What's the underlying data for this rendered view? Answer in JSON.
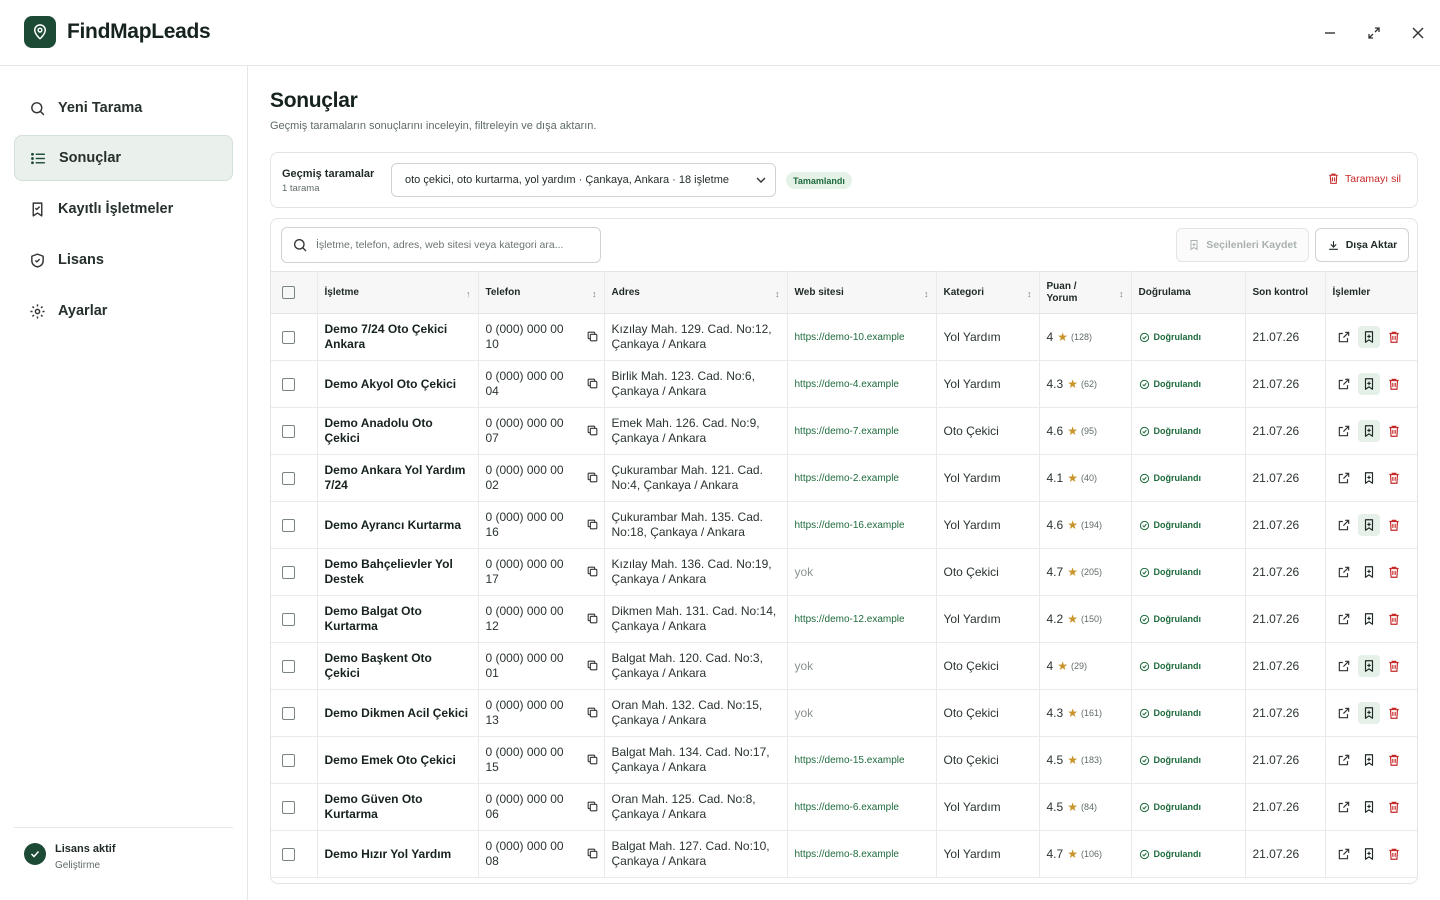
{
  "app": {
    "name": "FindMapLeads",
    "brand_color": "#1c4a35"
  },
  "sidebar": {
    "items": [
      {
        "label": "Yeni Tarama",
        "icon": "search-icon",
        "name": "sidebar-item-new-scan"
      },
      {
        "label": "Sonuçlar",
        "icon": "list-icon",
        "name": "sidebar-item-results",
        "active": true
      },
      {
        "label": "Kayıtlı İşletmeler",
        "icon": "bookmark-check-icon",
        "name": "sidebar-item-saved"
      },
      {
        "label": "Lisans",
        "icon": "shield-check-icon",
        "name": "sidebar-item-license"
      },
      {
        "label": "Ayarlar",
        "icon": "gear-icon",
        "name": "sidebar-item-settings"
      }
    ],
    "license": {
      "title": "Lisans aktif",
      "subtitle": "Geliştirme"
    }
  },
  "main": {
    "title": "Sonuçlar",
    "subtitle": "Geçmiş taramaların sonuçlarını inceleyin, filtreleyin ve dışa aktarın.",
    "filter": {
      "title": "Geçmiş taramalar",
      "count": "1 tarama",
      "selected_scan": "oto çekici, oto kurtarma, yol yardım · Çankaya, Ankara · 18 işletme",
      "status": "Tamamlandı",
      "delete_label": "Taramayı sil"
    },
    "toolbar": {
      "search_placeholder": "İşletme, telefon, adres, web sitesi veya kategori ara...",
      "save_selected": "Seçilenleri Kaydet",
      "export": "Dışa Aktar"
    },
    "table": {
      "headers": {
        "business": "İşletme",
        "phone": "Telefon",
        "address": "Adres",
        "website": "Web sitesi",
        "category": "Kategori",
        "rating": "Puan / Yorum",
        "verification": "Doğrulama",
        "last_check": "Son kontrol",
        "actions": "İşlemler"
      },
      "sort_icon": "↕",
      "sort_asc_icon": "↑",
      "rows": [
        {
          "name": "Demo 7/24 Oto Çekici Ankara",
          "phone": "0 (000) 000 00 10",
          "address": "Kızılay Mah. 129. Cad. No:12, Çankaya / Ankara",
          "website": "https://demo-10.example",
          "category": "Yol Yardım",
          "rating": "4",
          "reviews": "(128)",
          "verification": "Doğrulandı",
          "last_check": "21.07.26",
          "saved": true
        },
        {
          "name": "Demo Akyol Oto Çekici",
          "phone": "0 (000) 000 00 04",
          "address": "Birlik Mah. 123. Cad. No:6, Çankaya / Ankara",
          "website": "https://demo-4.example",
          "category": "Yol Yardım",
          "rating": "4.3",
          "reviews": "(62)",
          "verification": "Doğrulandı",
          "last_check": "21.07.26",
          "saved": true
        },
        {
          "name": "Demo Anadolu Oto Çekici",
          "phone": "0 (000) 000 00 07",
          "address": "Emek Mah. 126. Cad. No:9, Çankaya / Ankara",
          "website": "https://demo-7.example",
          "category": "Oto Çekici",
          "rating": "4.6",
          "reviews": "(95)",
          "verification": "Doğrulandı",
          "last_check": "21.07.26",
          "saved": true
        },
        {
          "name": "Demo Ankara Yol Yardım 7/24",
          "phone": "0 (000) 000 00 02",
          "address": "Çukurambar Mah. 121. Cad. No:4, Çankaya / Ankara",
          "website": "https://demo-2.example",
          "category": "Yol Yardım",
          "rating": "4.1",
          "reviews": "(40)",
          "verification": "Doğrulandı",
          "last_check": "21.07.26",
          "saved": false
        },
        {
          "name": "Demo Ayrancı Kurtarma",
          "phone": "0 (000) 000 00 16",
          "address": "Çukurambar Mah. 135. Cad. No:18, Çankaya / Ankara",
          "website": "https://demo-16.example",
          "category": "Yol Yardım",
          "rating": "4.6",
          "reviews": "(194)",
          "verification": "Doğrulandı",
          "last_check": "21.07.26",
          "saved": true
        },
        {
          "name": "Demo Bahçelievler Yol Destek",
          "phone": "0 (000) 000 00 17",
          "address": "Kızılay Mah. 136. Cad. No:19, Çankaya / Ankara",
          "website": "yok",
          "category": "Oto Çekici",
          "rating": "4.7",
          "reviews": "(205)",
          "verification": "Doğrulandı",
          "last_check": "21.07.26",
          "saved": false
        },
        {
          "name": "Demo Balgat Oto Kurtarma",
          "phone": "0 (000) 000 00 12",
          "address": "Dikmen Mah. 131. Cad. No:14, Çankaya / Ankara",
          "website": "https://demo-12.example",
          "category": "Yol Yardım",
          "rating": "4.2",
          "reviews": "(150)",
          "verification": "Doğrulandı",
          "last_check": "21.07.26",
          "saved": false
        },
        {
          "name": "Demo Başkent Oto Çekici",
          "phone": "0 (000) 000 00 01",
          "address": "Balgat Mah. 120. Cad. No:3, Çankaya / Ankara",
          "website": "yok",
          "category": "Oto Çekici",
          "rating": "4",
          "reviews": "(29)",
          "verification": "Doğrulandı",
          "last_check": "21.07.26",
          "saved": true
        },
        {
          "name": "Demo Dikmen Acil Çekici",
          "phone": "0 (000) 000 00 13",
          "address": "Oran Mah. 132. Cad. No:15, Çankaya / Ankara",
          "website": "yok",
          "category": "Oto Çekici",
          "rating": "4.3",
          "reviews": "(161)",
          "verification": "Doğrulandı",
          "last_check": "21.07.26",
          "saved": true
        },
        {
          "name": "Demo Emek Oto Çekici",
          "phone": "0 (000) 000 00 15",
          "address": "Balgat Mah. 134. Cad. No:17, Çankaya / Ankara",
          "website": "https://demo-15.example",
          "category": "Oto Çekici",
          "rating": "4.5",
          "reviews": "(183)",
          "verification": "Doğrulandı",
          "last_check": "21.07.26",
          "saved": false
        },
        {
          "name": "Demo Güven Oto Kurtarma",
          "phone": "0 (000) 000 00 06",
          "address": "Oran Mah. 125. Cad. No:8, Çankaya / Ankara",
          "website": "https://demo-6.example",
          "category": "Yol Yardım",
          "rating": "4.5",
          "reviews": "(84)",
          "verification": "Doğrulandı",
          "last_check": "21.07.26",
          "saved": false
        },
        {
          "name": "Demo Hızır Yol Yardım",
          "phone": "0 (000) 000 00 08",
          "address": "Balgat Mah. 127. Cad. No:10, Çankaya / Ankara",
          "website": "https://demo-8.example",
          "category": "Yol Yardım",
          "rating": "4.7",
          "reviews": "(106)",
          "verification": "Doğrulandı",
          "last_check": "21.07.26",
          "saved": false
        }
      ]
    }
  }
}
